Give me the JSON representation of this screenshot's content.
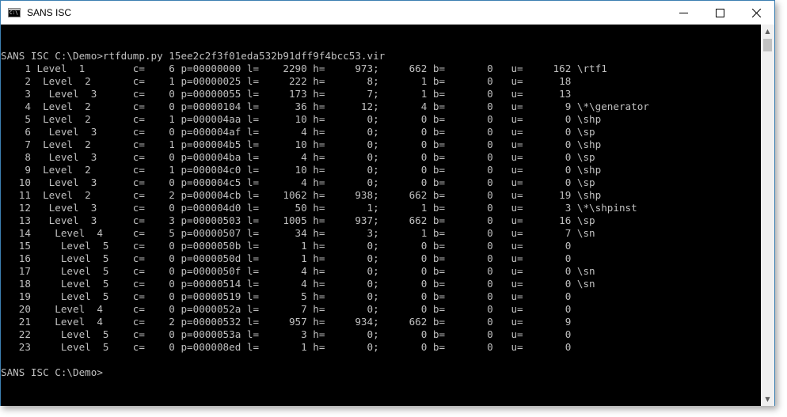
{
  "window": {
    "title": "SANS ISC",
    "minimize_icon": "minimize-icon",
    "maximize_icon": "maximize-icon",
    "close_icon": "close-icon"
  },
  "console": {
    "command_line": "SANS ISC C:\\Demo>rtfdump.py 15ee2c2f3f01eda532b91dff9f4bcc53.vir",
    "rows": [
      "    1 Level  1        c=    6 p=00000000 l=    2290 h=     973;     662 b=       0   u=     162 \\rtf1",
      "    2  Level  2       c=    1 p=00000025 l=     222 h=       8;       1 b=       0   u=      18",
      "    3   Level  3      c=    0 p=00000055 l=     173 h=       7;       1 b=       0   u=      13",
      "    4  Level  2       c=    0 p=00000104 l=      36 h=      12;       4 b=       0   u=       9 \\*\\generator",
      "    5  Level  2       c=    1 p=000004aa l=      10 h=       0;       0 b=       0   u=       0 \\shp",
      "    6   Level  3      c=    0 p=000004af l=       4 h=       0;       0 b=       0   u=       0 \\sp",
      "    7  Level  2       c=    1 p=000004b5 l=      10 h=       0;       0 b=       0   u=       0 \\shp",
      "    8   Level  3      c=    0 p=000004ba l=       4 h=       0;       0 b=       0   u=       0 \\sp",
      "    9  Level  2       c=    1 p=000004c0 l=      10 h=       0;       0 b=       0   u=       0 \\shp",
      "   10   Level  3      c=    0 p=000004c5 l=       4 h=       0;       0 b=       0   u=       0 \\sp",
      "   11  Level  2       c=    2 p=000004cb l=    1062 h=     938;     662 b=       0   u=      19 \\shp",
      "   12   Level  3      c=    0 p=000004d0 l=      50 h=       1;       1 b=       0   u=       3 \\*\\shpinst",
      "   13   Level  3      c=    3 p=00000503 l=    1005 h=     937;     662 b=       0   u=      16 \\sp",
      "   14    Level  4     c=    5 p=00000507 l=      34 h=       3;       1 b=       0   u=       7 \\sn",
      "   15     Level  5    c=    0 p=0000050b l=       1 h=       0;       0 b=       0   u=       0",
      "   16     Level  5    c=    0 p=0000050d l=       1 h=       0;       0 b=       0   u=       0",
      "   17     Level  5    c=    0 p=0000050f l=       4 h=       0;       0 b=       0   u=       0 \\sn",
      "   18     Level  5    c=    0 p=00000514 l=       4 h=       0;       0 b=       0   u=       0 \\sn",
      "   19     Level  5    c=    0 p=00000519 l=       5 h=       0;       0 b=       0   u=       0",
      "   20    Level  4     c=    0 p=0000052a l=       7 h=       0;       0 b=       0   u=       0",
      "   21    Level  4     c=    2 p=00000532 l=     957 h=     934;     662 b=       0   u=       9",
      "   22     Level  5    c=    0 p=0000053a l=       3 h=       0;       0 b=       0   u=       0",
      "   23     Level  5    c=    0 p=000008ed l=       1 h=       0;       0 b=       0   u=       0"
    ],
    "prompt": "SANS ISC C:\\Demo>"
  }
}
